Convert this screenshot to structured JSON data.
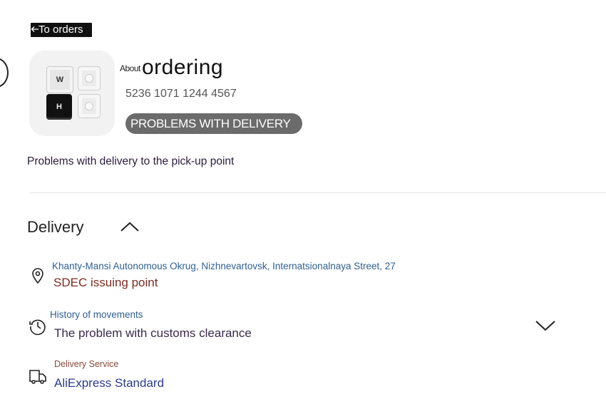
{
  "nav": {
    "back_label": "To orders"
  },
  "order": {
    "about_label": "About",
    "title": "ordering",
    "number": "5236 1071 1244 4567",
    "status_badge": "PROBLEMS WITH DELIVERY",
    "problem_description": "Problems with delivery to the pick-up point",
    "product_image": {
      "keys": [
        "W",
        "H"
      ]
    }
  },
  "delivery": {
    "section_title": "Delivery",
    "address_line": "Khanty-Mansi Autonomous Okrug, Nizhnevartovsk, Internatsionalnaya Street, 27",
    "pickup_point": "SDEC issuing point",
    "history_label": "History of movements",
    "history_status": "The problem with customs clearance",
    "service_label": "Delivery Service",
    "service_name": "AliExpress Standard"
  },
  "icons": {
    "back": "arrow-left-icon",
    "section_toggle": "chevron-up-icon",
    "location": "location-pin-icon",
    "history": "history-clock-icon",
    "history_toggle": "chevron-down-icon",
    "service": "truck-icon"
  },
  "colors": {
    "badge_bg": "#6b6b6b",
    "link_blue": "#2e5f93",
    "pickup_text": "#7b2b22",
    "service_text": "#2b3a8f"
  }
}
